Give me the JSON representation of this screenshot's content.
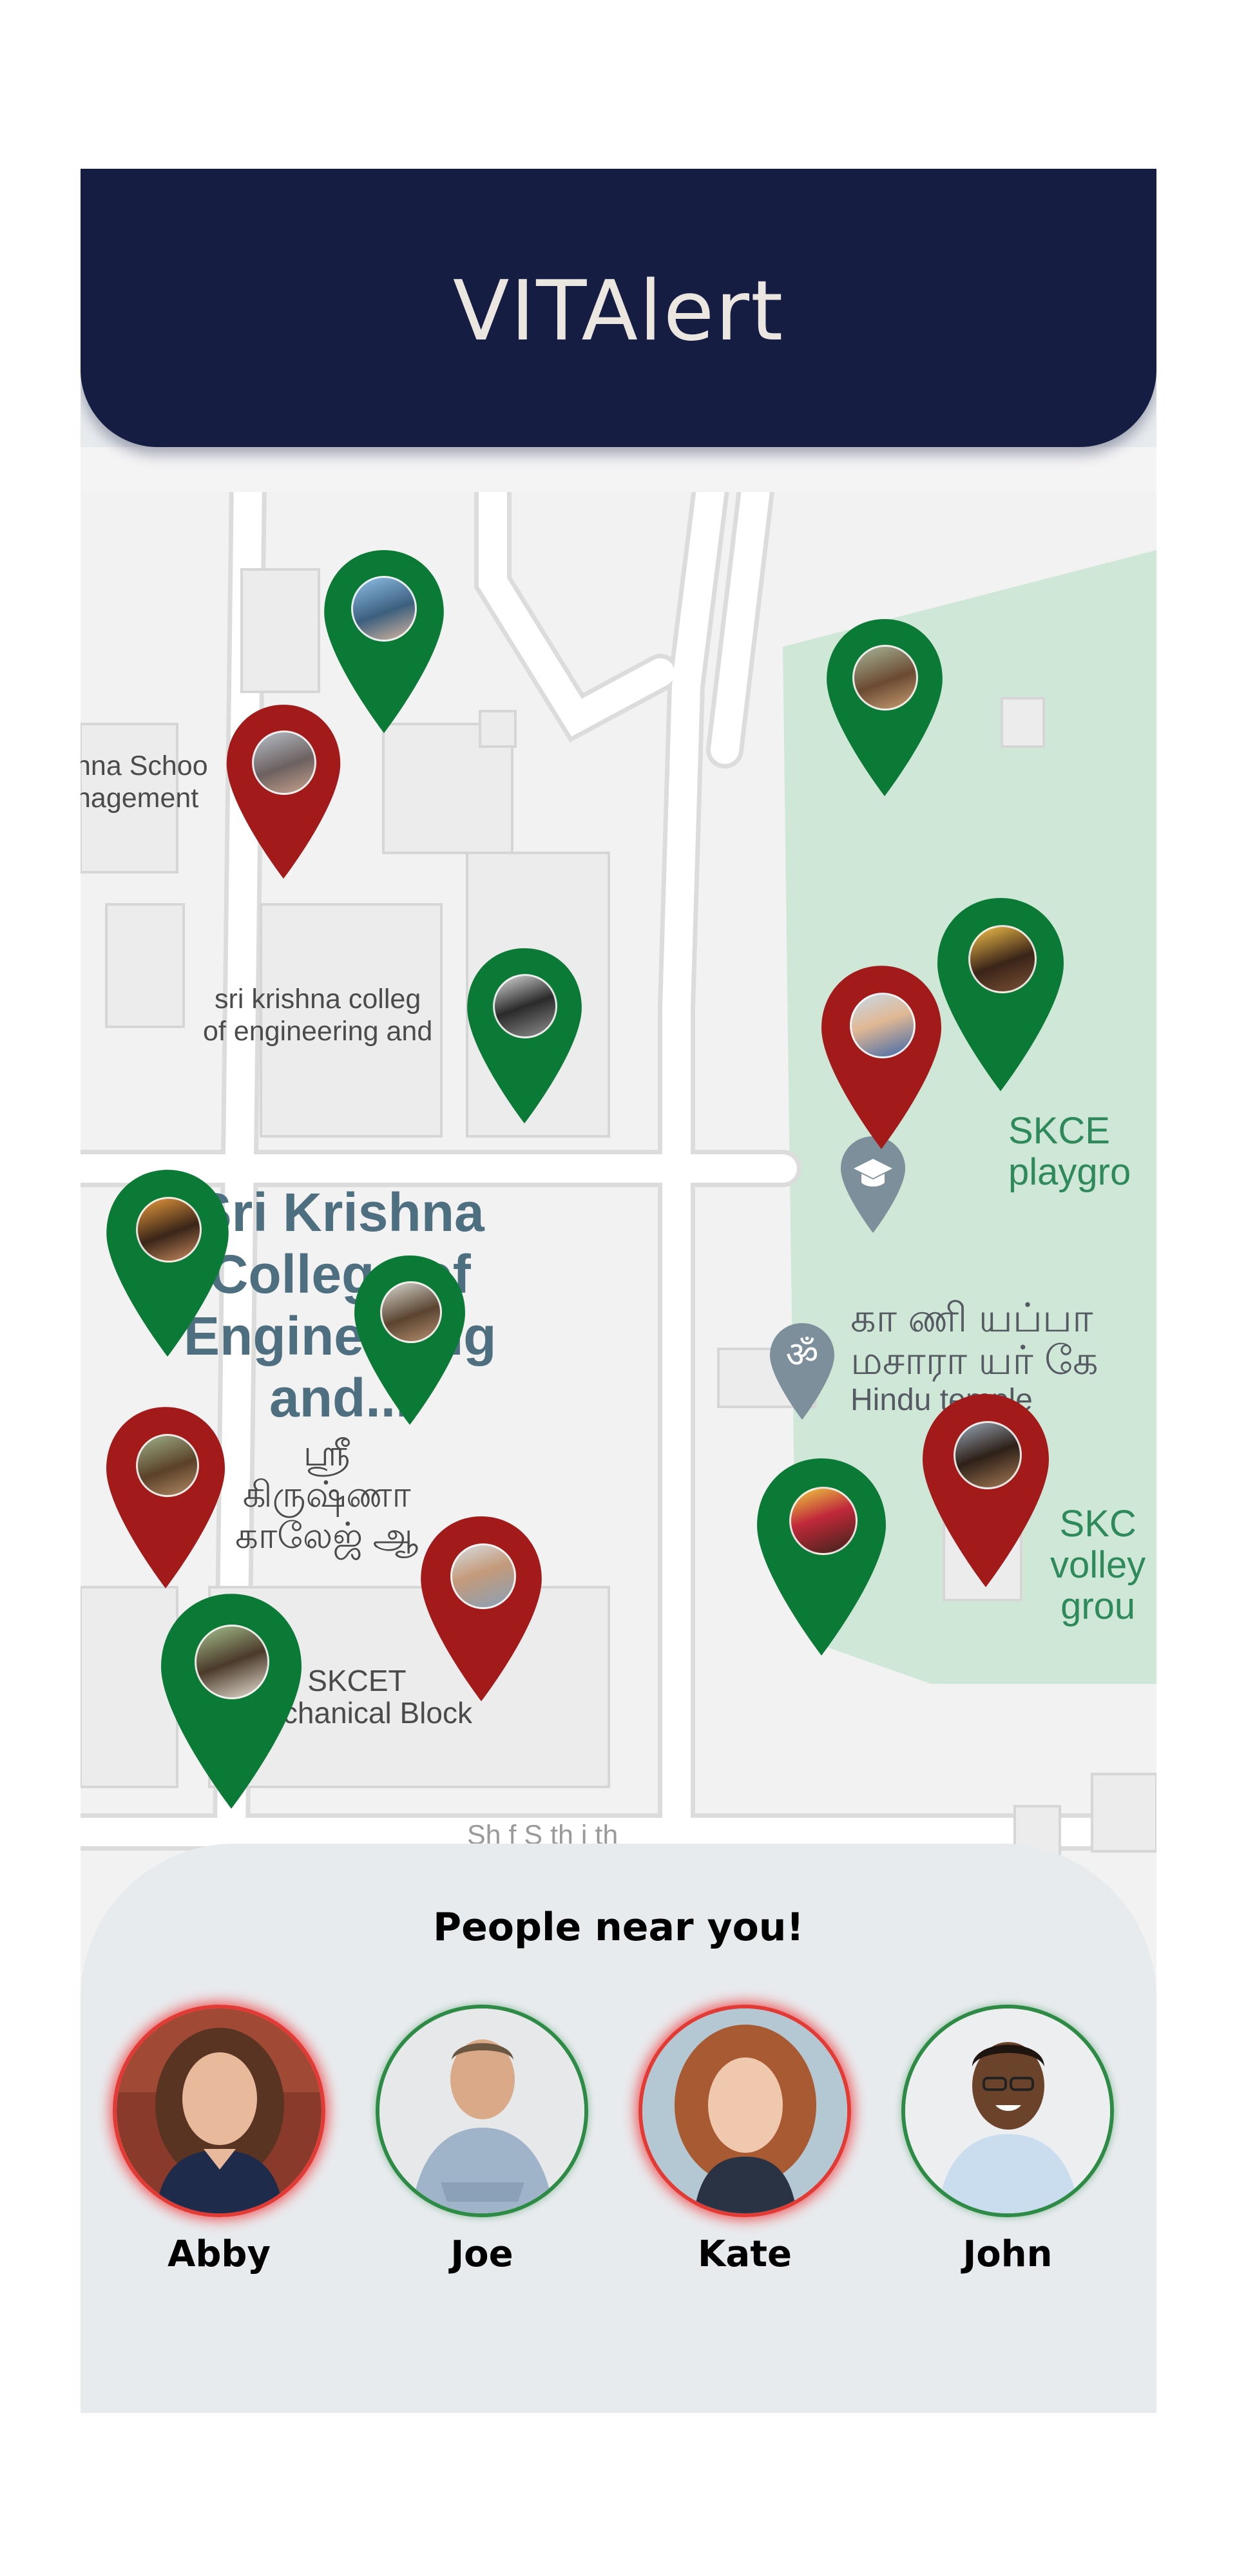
{
  "app": {
    "title": "VITAlert"
  },
  "map": {
    "labels": {
      "school_line1": "hna Schoo",
      "school_line2": "nagement",
      "college_small_line1": "sri krishna colleg",
      "college_small_line2": "of engineering and",
      "college_big_line1": "Sri Krishna",
      "college_big_line2": "College of",
      "college_big_line3": "Engineering",
      "college_big_line4": "and...",
      "tamil_line1": "ஸ்ரீ",
      "tamil_line2": "கிருஷ்ணா",
      "tamil_line3": "காலேஜ் ஆ",
      "mech_line1": "SKCET",
      "mech_line2": "Mechanical Block",
      "playground_line1": "SKCE",
      "playground_line2": "playgro",
      "temple_line1": "கா ணி யப்பா",
      "temple_line2": "மசாரா யர் கே",
      "temple_line3": "Hindu temple",
      "volley_line1": "SKC",
      "volley_line2": "volley",
      "volley_line3": "grou",
      "road_partial": "Sh f  S  th  i  th"
    },
    "pins": [
      {
        "color": "green",
        "status": "safe"
      },
      {
        "color": "red",
        "status": "alert"
      },
      {
        "color": "green",
        "status": "safe"
      },
      {
        "color": "green",
        "status": "safe"
      },
      {
        "color": "green",
        "status": "safe"
      },
      {
        "color": "red",
        "status": "alert"
      },
      {
        "color": "green",
        "status": "safe"
      },
      {
        "color": "green",
        "status": "safe"
      },
      {
        "color": "red",
        "status": "alert"
      },
      {
        "color": "red",
        "status": "alert"
      },
      {
        "color": "green",
        "status": "safe"
      },
      {
        "color": "green",
        "status": "safe"
      },
      {
        "color": "red",
        "status": "alert"
      }
    ]
  },
  "nearby": {
    "title": "People near you!",
    "people": [
      {
        "name": "Abby",
        "status": "red"
      },
      {
        "name": "Joe",
        "status": "green"
      },
      {
        "name": "Kate",
        "status": "red"
      },
      {
        "name": "John",
        "status": "green"
      }
    ]
  },
  "colors": {
    "header": "#161d43",
    "alert_red": "#a31a1a",
    "safe_green": "#0b7a36",
    "map_park": "#cfe7d6",
    "panel": "#e8ebee"
  }
}
